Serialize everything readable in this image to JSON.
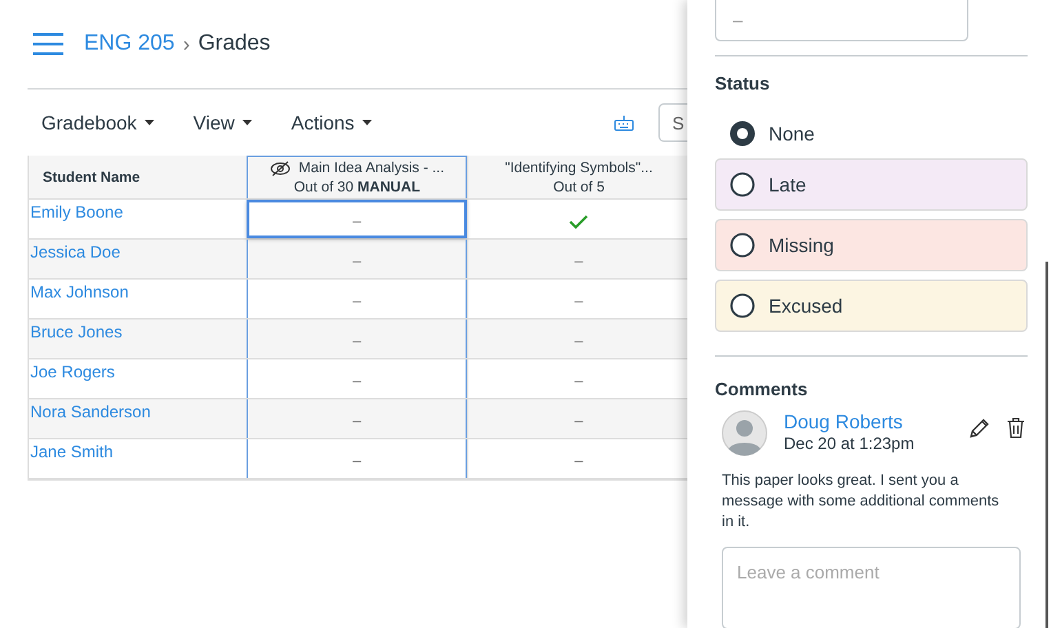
{
  "breadcrumb": {
    "course": "ENG 205",
    "separator": "›",
    "page": "Grades"
  },
  "toolbar": {
    "menus": [
      "Gradebook",
      "View",
      "Actions"
    ],
    "search": {
      "placeholder": "S"
    }
  },
  "table": {
    "columns": [
      {
        "title": "Student Name"
      },
      {
        "title": "Main Idea Analysis - ...",
        "subtitle": "Out of 30",
        "badge": "MANUAL",
        "hidden": true,
        "selected": true
      },
      {
        "title": "\"Identifying Symbols\"...",
        "subtitle": "Out of 5",
        "hidden": false,
        "selected": false
      }
    ],
    "rows": [
      {
        "cells": [
          {
            "kind": "student",
            "text": "Emily Boone"
          },
          {
            "kind": "text",
            "text": "–",
            "selected": true
          },
          {
            "kind": "check",
            "selected": false
          }
        ]
      },
      {
        "cells": [
          {
            "kind": "student",
            "text": "Jessica Doe"
          },
          {
            "kind": "text",
            "text": "–",
            "selected": false
          },
          {
            "kind": "text",
            "text": "–",
            "selected": false
          }
        ]
      },
      {
        "cells": [
          {
            "kind": "student",
            "text": "Max Johnson"
          },
          {
            "kind": "text",
            "text": "–",
            "selected": false
          },
          {
            "kind": "text",
            "text": "–",
            "selected": false
          }
        ]
      },
      {
        "cells": [
          {
            "kind": "student",
            "text": "Bruce Jones"
          },
          {
            "kind": "text",
            "text": "–",
            "selected": false
          },
          {
            "kind": "text",
            "text": "–",
            "selected": false
          }
        ]
      },
      {
        "cells": [
          {
            "kind": "student",
            "text": "Joe Rogers"
          },
          {
            "kind": "text",
            "text": "–",
            "selected": false
          },
          {
            "kind": "text",
            "text": "–",
            "selected": false
          }
        ]
      },
      {
        "cells": [
          {
            "kind": "student",
            "text": "Nora Sanderson"
          },
          {
            "kind": "text",
            "text": "–",
            "selected": false
          },
          {
            "kind": "text",
            "text": "–",
            "selected": false
          }
        ]
      },
      {
        "cells": [
          {
            "kind": "student",
            "text": "Jane Smith"
          },
          {
            "kind": "text",
            "text": "–",
            "selected": false
          },
          {
            "kind": "text",
            "text": "–",
            "selected": false
          }
        ]
      }
    ]
  },
  "tray": {
    "grade_field": {
      "placeholder": "–"
    },
    "status": {
      "title": "Status",
      "options": [
        {
          "label": "None",
          "selected": true
        },
        {
          "label": "Late",
          "selected": false,
          "color": "#f4eaf6"
        },
        {
          "label": "Missing",
          "selected": false,
          "color": "#fce6e2"
        },
        {
          "label": "Excused",
          "selected": false,
          "color": "#fcf5e2"
        }
      ]
    },
    "comments": {
      "title": "Comments",
      "items": [
        {
          "author": "Doug Roberts",
          "date": "Dec 20 at 1:23pm",
          "body": "This paper looks great. I sent you a message with some additional comments in it."
        }
      ],
      "input": {
        "placeholder": "Leave a comment"
      }
    }
  }
}
